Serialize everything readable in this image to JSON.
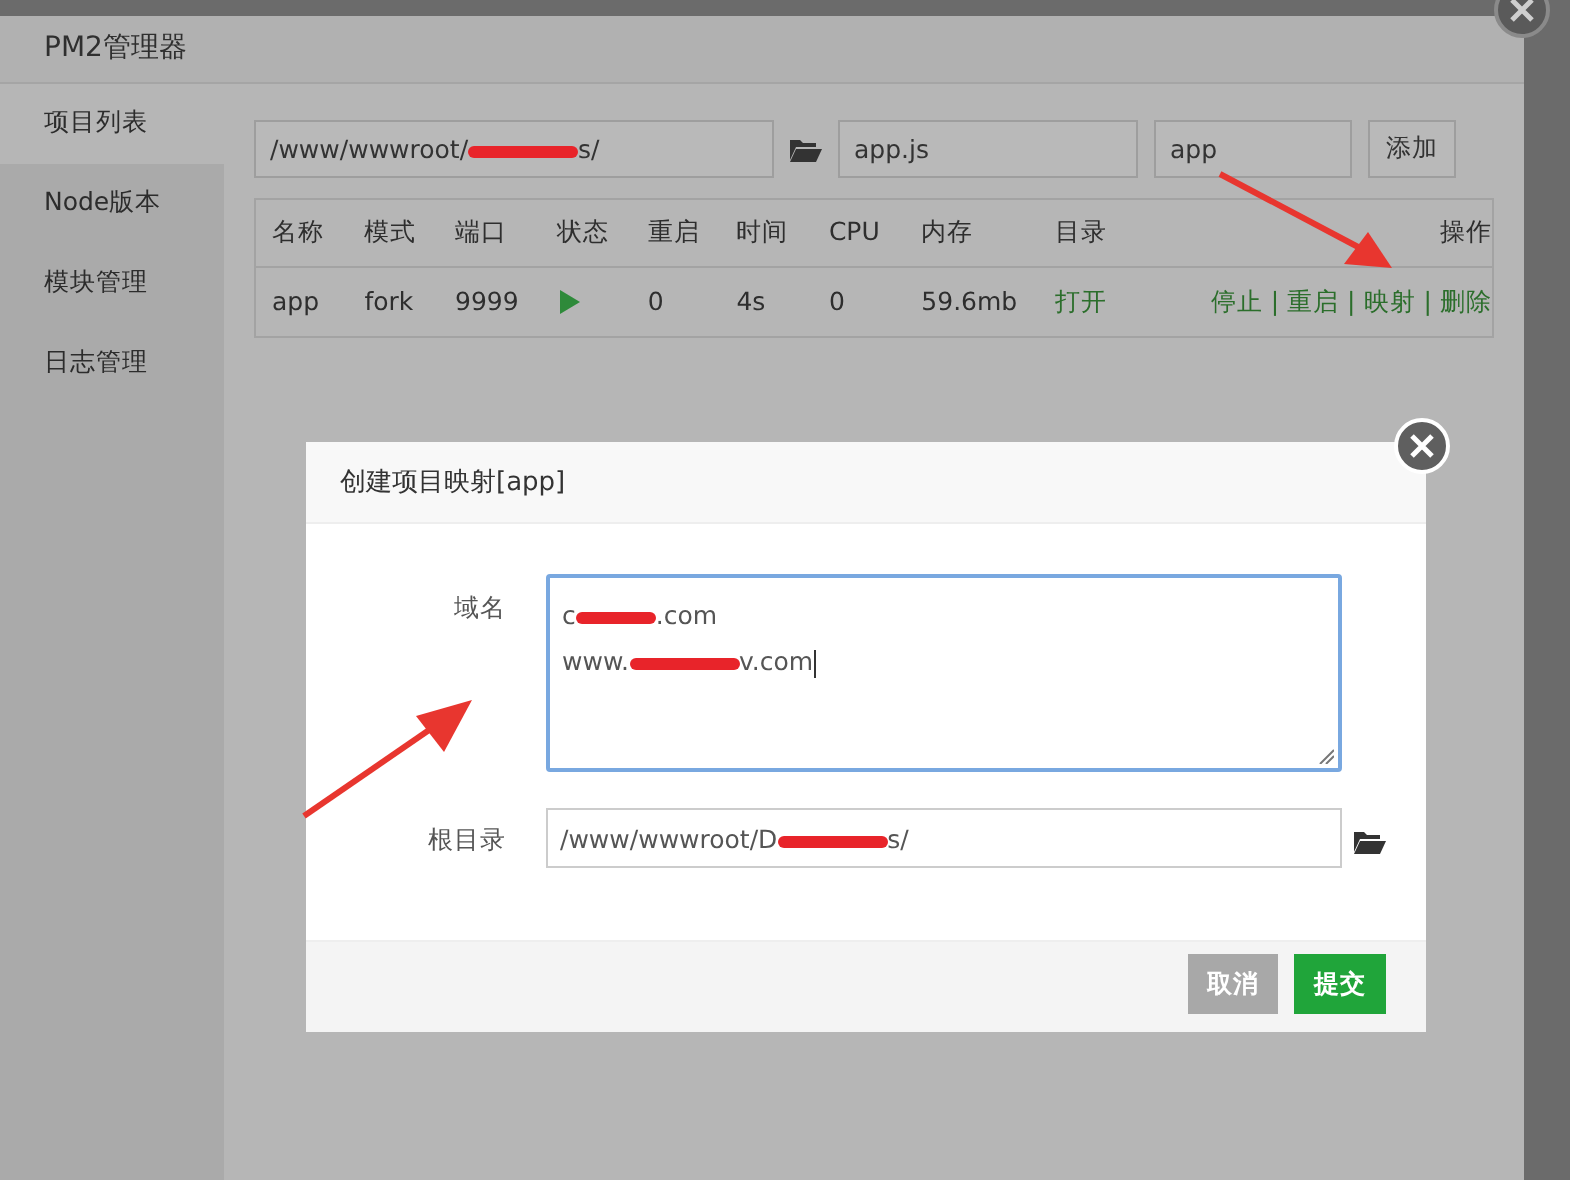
{
  "window": {
    "title": "PM2管理器"
  },
  "sidebar": {
    "items": [
      {
        "label": "项目列表",
        "selected": true
      },
      {
        "label": "Node版本",
        "selected": false
      },
      {
        "label": "模块管理",
        "selected": false
      },
      {
        "label": "日志管理",
        "selected": false
      }
    ]
  },
  "add_form": {
    "path": {
      "before": "/www/wwwroot/",
      "after": "s/",
      "redacted": true
    },
    "file": "app.js",
    "name": "app",
    "button": "添加"
  },
  "table": {
    "columns": [
      "名称",
      "模式",
      "端口",
      "状态",
      "重启",
      "时间",
      "CPU",
      "内存",
      "目录",
      "操作"
    ],
    "rows": [
      {
        "name": "app",
        "mode": "fork",
        "port": "9999",
        "running": true,
        "restarts": "0",
        "time": "4s",
        "cpu": "0",
        "memory": "59.6mb",
        "dir_link": "打开",
        "actions": [
          "停止",
          "重启",
          "映射",
          "删除"
        ],
        "action_separator": "|"
      }
    ]
  },
  "dialog": {
    "title": "创建项目映射[app]",
    "fields": [
      {
        "kind": "textarea",
        "label": "域名",
        "focused": true,
        "lines": [
          {
            "before": "c",
            "after": ".com",
            "redacted": true
          },
          {
            "before": "www.",
            "after": "v.com",
            "redacted": true
          }
        ]
      },
      {
        "kind": "input",
        "label": "根目录",
        "focused": false,
        "value": {
          "before": "/www/wwwroot/D",
          "after": "s/",
          "redacted": true
        }
      }
    ],
    "buttons": [
      {
        "label": "取消",
        "kind": "secondary"
      },
      {
        "label": "提交",
        "kind": "primary"
      }
    ]
  }
}
